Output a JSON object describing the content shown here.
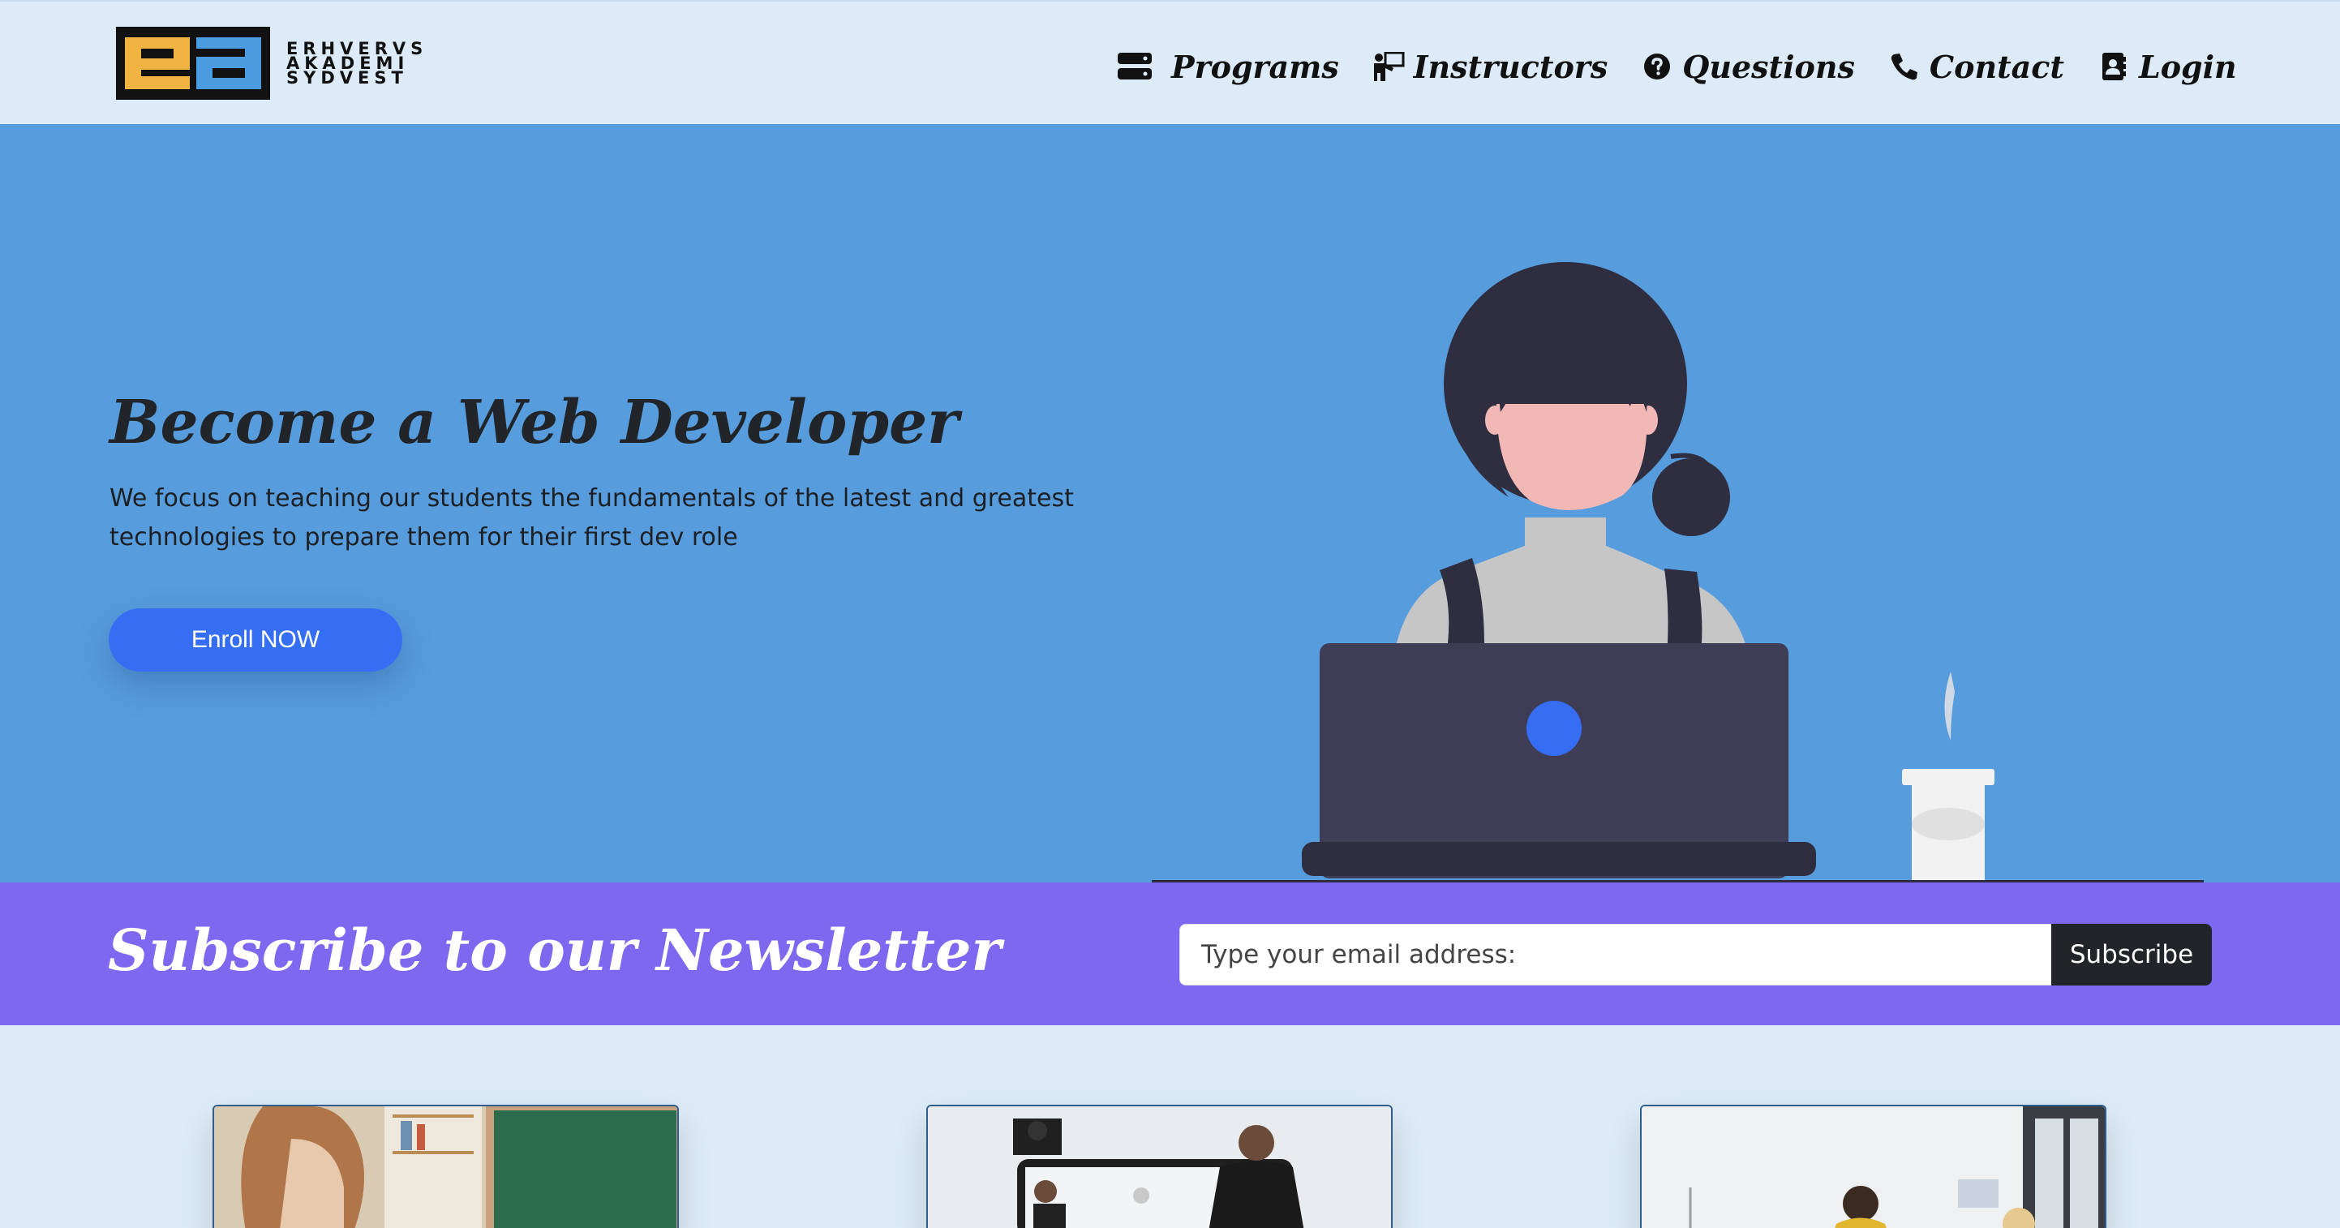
{
  "brand": {
    "line1": "ERHVERVS",
    "line2": "AKADEMI",
    "line3": "SYDVEST",
    "colors": {
      "yellow": "#f2b441",
      "blue": "#4b9be0",
      "dark": "#111111"
    }
  },
  "nav": {
    "menu_icon": "server-stack-icon",
    "items": [
      {
        "label": "Programs",
        "icon": ""
      },
      {
        "label": "Instructors",
        "icon": "chalkboard-teacher-icon"
      },
      {
        "label": "Questions",
        "icon": "question-circle-icon"
      },
      {
        "label": "Contact",
        "icon": "phone-icon"
      },
      {
        "label": "Login",
        "icon": "address-book-icon"
      }
    ]
  },
  "hero": {
    "title": "Become a Web Developer",
    "subtitle": "We focus on teaching our students the fundamentals of the latest and greatest technologies to prepare them for their first dev role",
    "cta_label": "Enroll NOW",
    "colors": {
      "background": "#579ddd",
      "button": "#356ef2"
    }
  },
  "newsletter": {
    "title": "Subscribe to our Newsletter",
    "email_placeholder": "Type your email address:",
    "email_value": "",
    "button_label": "Subscribe",
    "colors": {
      "background": "#7f68f0",
      "button": "#212529"
    }
  },
  "cards": [
    {
      "image": "student-laptop-classroom-photo"
    },
    {
      "image": "men-in-suits-celebrating-photo"
    },
    {
      "image": "office-meeting-photo"
    }
  ]
}
